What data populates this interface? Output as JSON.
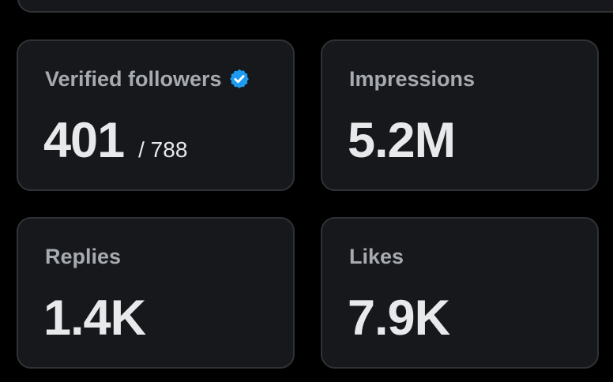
{
  "colors": {
    "background": "#000000",
    "card_background": "#16181c",
    "card_border": "#2f3336",
    "label": "#a7abb0",
    "value": "#e7e9ea",
    "verified_badge": "#1d9bf0"
  },
  "stats": {
    "verified_followers": {
      "label": "Verified followers",
      "value": "401",
      "total": "/ 788",
      "icon": "verified-badge-icon"
    },
    "impressions": {
      "label": "Impressions",
      "value": "5.2M"
    },
    "replies": {
      "label": "Replies",
      "value": "1.4K"
    },
    "likes": {
      "label": "Likes",
      "value": "7.9K"
    }
  }
}
